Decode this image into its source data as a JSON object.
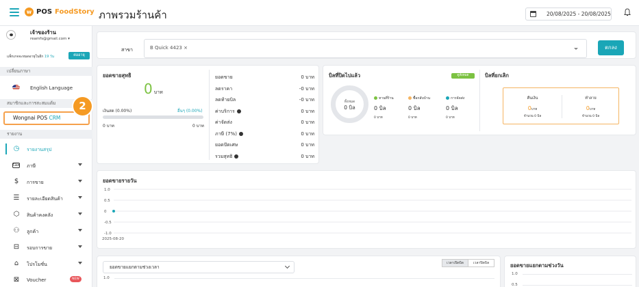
{
  "topbar": {
    "brand_pos": "POS",
    "brand_name": "FoodStory",
    "page_title": "ภาพรวมร้านค้า",
    "date_range": "20/08/2025 - 20/08/2025"
  },
  "sidebar": {
    "user_name": "เจ้าของร้าน",
    "user_email": "reamfs@gmail.com",
    "package_text": "แพ็กเกจจะหมดอายุในอีก",
    "package_days": "19 วัน",
    "renew_label": "ต่ออายุ",
    "lang_header": "เปลี่ยนภาษา",
    "lang_label": "English Language",
    "member_header": "สมาชิกและการสะสมแต้ม",
    "crm_prefix": "Wongnai POS",
    "crm_suffix": "CRM",
    "step_badge": "2",
    "report_header": "รายงาน",
    "items": [
      {
        "label": "รายงานสรุป",
        "icon": "clock-icon"
      },
      {
        "label": "ภาษี",
        "icon": "tax-icon"
      },
      {
        "label": "การขาย",
        "icon": "dollar-icon"
      },
      {
        "label": "รายละเอียดสินค้า",
        "icon": "list-icon"
      },
      {
        "label": "สินค้าคงคลัง",
        "icon": "box-icon"
      },
      {
        "label": "ลูกค้า",
        "icon": "users-icon"
      },
      {
        "label": "รอบการขาย",
        "icon": "inbox-icon"
      },
      {
        "label": "โปรโมชั่น",
        "icon": "tag-icon"
      },
      {
        "label": "Voucher",
        "icon": "voucher-icon",
        "badge": "NEW"
      }
    ]
  },
  "branch": {
    "label": "สาขา",
    "selected": "B Quick 4423",
    "remove": "×",
    "ok_label": "ตกลง"
  },
  "net_sales": {
    "title": "ยอดขายสุทธิ",
    "amount": "0",
    "unit": "บาท",
    "change_left": "เงินสด (0.00%)",
    "change_right": "อื่นๆ (0.00%)",
    "left_val": "0 บาท",
    "right_val": "0 บาท",
    "rows": [
      {
        "k": "ยอดขาย",
        "v": "0 บาท"
      },
      {
        "k": "ลดราคา",
        "v": "-0 บาท"
      },
      {
        "k": "ลดท้ายบิล",
        "v": "-0 บาท"
      },
      {
        "k": "ค่าบริการ",
        "v": "0 บาท",
        "info": true
      },
      {
        "k": "ค่าจัดส่ง",
        "v": "0 บาท"
      },
      {
        "k": "ภาษี (7%)",
        "v": "0 บาท",
        "info": true
      },
      {
        "k": "ยอดปัดเศษ",
        "v": "0 บาท"
      },
      {
        "k": "รวมสุทธิ",
        "v": "0 บาท",
        "info": true
      }
    ]
  },
  "closed_bills": {
    "title": "บิลที่ปิดไปแล้ว",
    "detail_btn": "ดูทั้งหมด",
    "ring_label": "ทั้งหมด",
    "ring_value": "0 บิล",
    "legend": [
      {
        "name": "ทานที่ร้าน",
        "color": "#7cc242",
        "count": "0 บิล",
        "amount": "0 บาท"
      },
      {
        "name": "ซื้อกลับบ้าน",
        "color": "#f5b461",
        "count": "0 บิล",
        "amount": "0 บาท"
      },
      {
        "name": "การจัดส่ง",
        "color": "#1aa6b7",
        "count": "0 บิล",
        "amount": "0 บาท"
      }
    ]
  },
  "cancelled_bills": {
    "title": "บิลที่ยกเลิก",
    "cols": [
      {
        "label": "คืนเงิน",
        "value": "0",
        "unit": "บาท",
        "sub": "จำนวน 0 บิล"
      },
      {
        "label": "ทำลาย",
        "value": "0",
        "unit": "บาท",
        "sub": "จำนวน 0 บิล"
      }
    ]
  },
  "daily_chart_title": "ยอดขายรายวัน",
  "chart_data": {
    "type": "line",
    "title": "ยอดขายรายวัน",
    "x": [
      "2025-08-20"
    ],
    "series": [
      {
        "values": [
          0
        ],
        "color": "#1aa6b7"
      }
    ],
    "yticks": [
      "1.0",
      "0.5",
      "0",
      "-0.5",
      "-1.0"
    ],
    "ylim": [
      -1.0,
      1.0
    ],
    "grid": true
  },
  "time_chart": {
    "dropdown": "ยอดขายแยกตามช่วงเวลา",
    "seg_open": "เวลาเปิดบิล",
    "seg_close": "เวลาปิดบิล",
    "ytop": "1.0"
  },
  "weekday_chart": {
    "title": "ยอดขายแยกตามช่วงวัน",
    "y1": "1.0",
    "y2": "0.5"
  }
}
